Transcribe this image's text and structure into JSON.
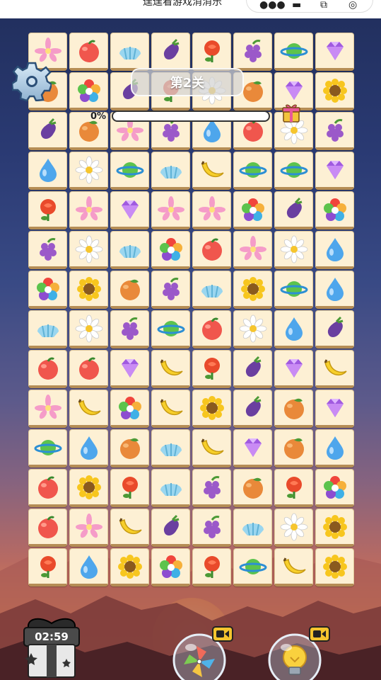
{
  "app": {
    "title": "逞逞看游戏消消乐",
    "capsule_icons": [
      "more-dots-icon",
      "minimize-icon",
      "share-icon",
      "close-target-icon"
    ]
  },
  "hud": {
    "level_label": "第2关",
    "progress_label": "0%",
    "progress_value": 0,
    "timer": "02:59"
  },
  "boosters": [
    {
      "name": "shuffle",
      "icon": "pinwheel-icon",
      "badge": "video-icon"
    },
    {
      "name": "hint",
      "icon": "lightbulb-icon",
      "badge": "video-icon"
    }
  ],
  "board": {
    "columns": 8,
    "rows": 14,
    "tiles": [
      [
        "lily",
        "peach",
        "shell",
        "eggplant",
        "rose",
        "grape",
        "planet",
        "gem"
      ],
      [
        "orange",
        "flower",
        "eggplant",
        "rose",
        "daisy",
        "orange",
        "gem",
        "sunflower"
      ],
      [
        "eggplant",
        "orange",
        "lily",
        "grape",
        "drop",
        "peach",
        "daisy",
        "grape"
      ],
      [
        "drop",
        "daisy",
        "planet",
        "shell",
        "banana",
        "planet",
        "planet",
        "gem"
      ],
      [
        "rose",
        "lily",
        "gem",
        "lily",
        "lily",
        "flower",
        "eggplant",
        "flower"
      ],
      [
        "grape",
        "daisy",
        "shell",
        "flower",
        "peach",
        "lily",
        "daisy",
        "drop"
      ],
      [
        "flower",
        "sunflower",
        "orange",
        "grape",
        "shell",
        "sunflower",
        "planet",
        "drop"
      ],
      [
        "shell",
        "daisy",
        "grape",
        "planet",
        "peach",
        "daisy",
        "drop",
        "eggplant"
      ],
      [
        "peach",
        "peach",
        "gem",
        "banana",
        "rose",
        "eggplant",
        "gem",
        "banana"
      ],
      [
        "lily",
        "banana",
        "flower",
        "banana",
        "sunflower",
        "eggplant",
        "orange",
        "gem"
      ],
      [
        "planet",
        "drop",
        "orange",
        "shell",
        "banana",
        "gem",
        "orange",
        "drop"
      ],
      [
        "peach",
        "sunflower",
        "rose",
        "shell",
        "grape",
        "orange",
        "rose",
        "flower"
      ],
      [
        "peach",
        "lily",
        "banana",
        "eggplant",
        "grape",
        "shell",
        "daisy",
        "sunflower"
      ],
      [
        "rose",
        "drop",
        "sunflower",
        "flower",
        "rose",
        "planet",
        "banana",
        "sunflower"
      ]
    ]
  }
}
